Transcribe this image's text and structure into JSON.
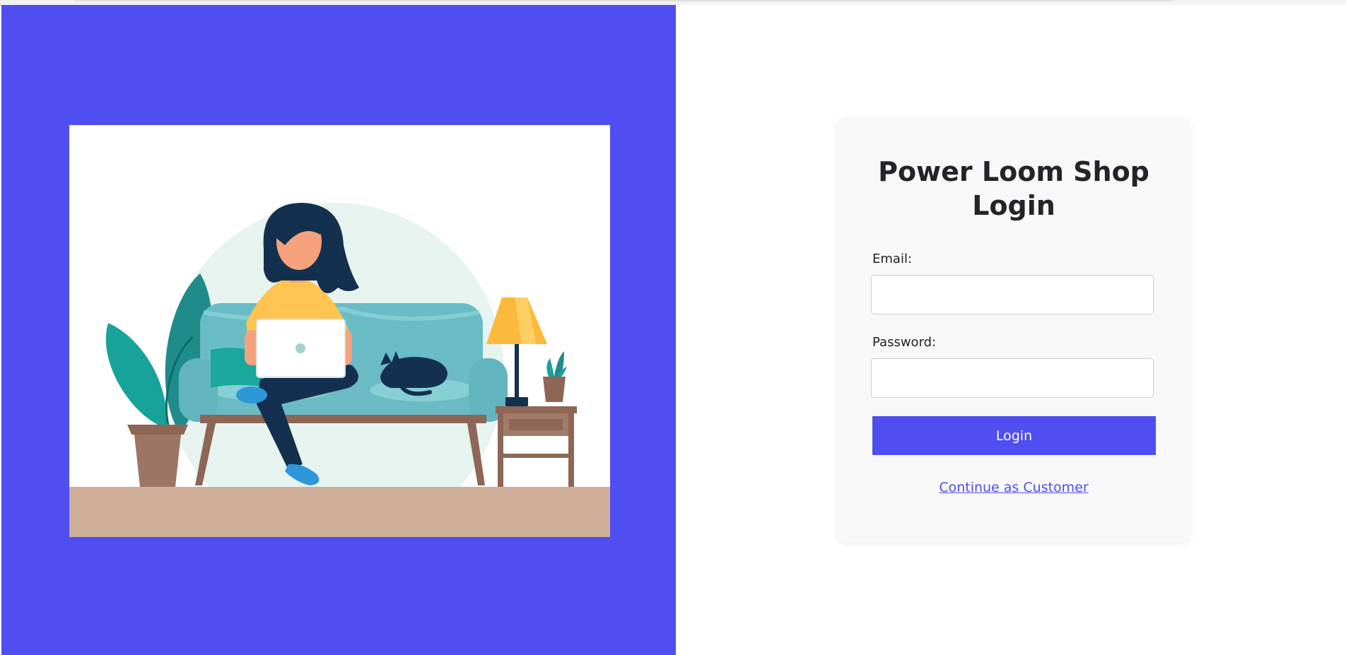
{
  "colors": {
    "accent": "#4f4ef0",
    "card_background": "#f8f8f8",
    "text": "#222428"
  },
  "illustration": {
    "subject": "woman-with-laptop-on-sofa-illustration"
  },
  "login": {
    "title": "Power Loom Shop Login",
    "email_label": "Email:",
    "email_value": "",
    "password_label": "Password:",
    "password_value": "",
    "submit_label": "Login",
    "customer_link": "Continue as Customer"
  }
}
